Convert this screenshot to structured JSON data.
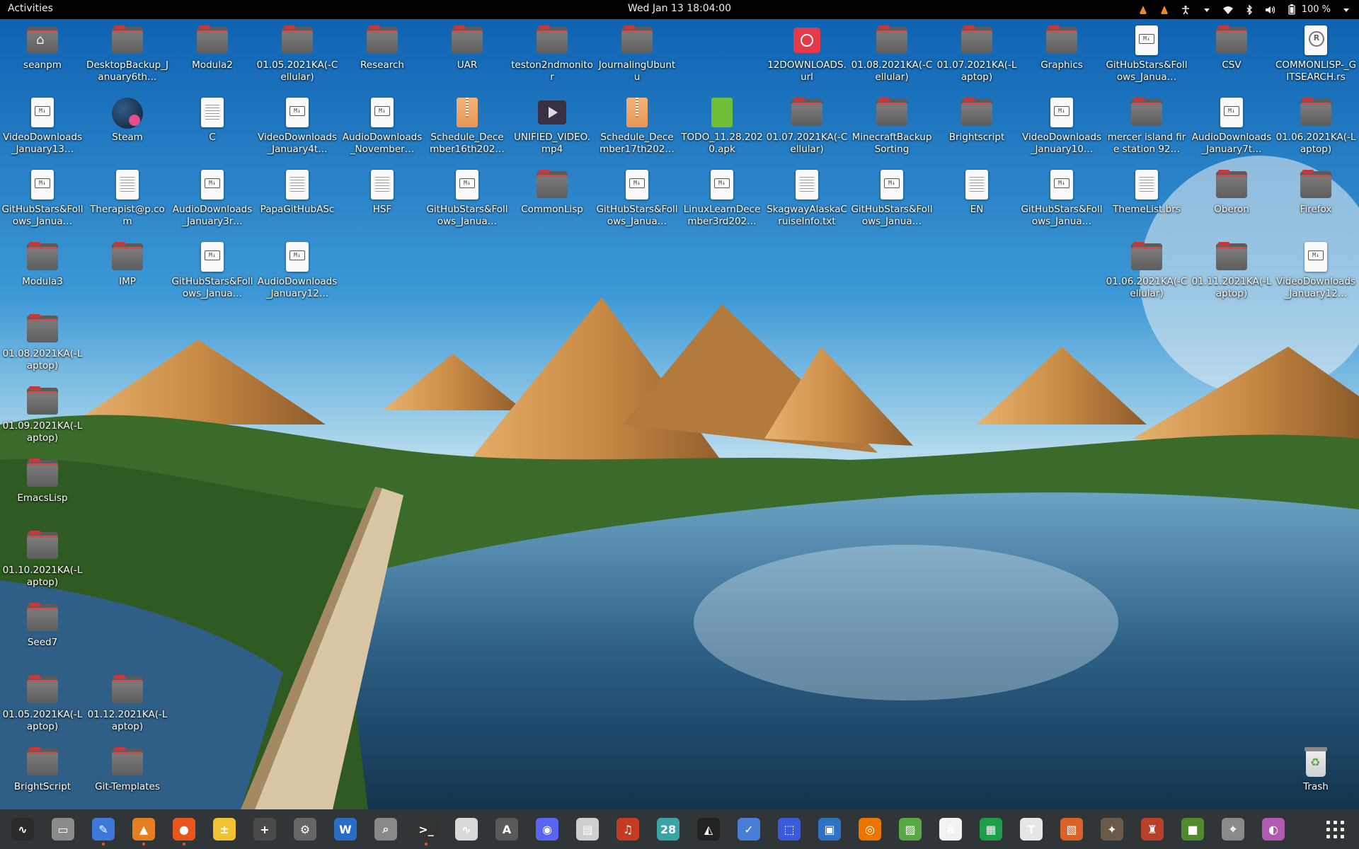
{
  "topbar": {
    "activities": "Activities",
    "clock": "Wed Jan 13  18:04:00",
    "battery": "100 %"
  },
  "desktop": {
    "icons": [
      {
        "label": "seanpm",
        "kind": "home"
      },
      {
        "label": "DesktopBackup_January6th…",
        "kind": "folder"
      },
      {
        "label": "Modula2",
        "kind": "folder"
      },
      {
        "label": "01.05.2021KA(-Cellular)",
        "kind": "folder"
      },
      {
        "label": "Research",
        "kind": "folder"
      },
      {
        "label": "UAR",
        "kind": "folder"
      },
      {
        "label": "teston2ndmonitor",
        "kind": "folder"
      },
      {
        "label": "JournalingUbuntu",
        "kind": "folder"
      },
      {
        "label": "12DOWNLOADS.url",
        "kind": "url"
      },
      {
        "label": "01.08.2021KA(-Cellular)",
        "kind": "folder"
      },
      {
        "label": "01.07.2021KA(-Laptop)",
        "kind": "folder"
      },
      {
        "label": "Graphics",
        "kind": "folder"
      },
      {
        "label": "GitHubStars&Follows_Janua…",
        "kind": "md"
      },
      {
        "label": "CSV",
        "kind": "folder"
      },
      {
        "label": "COMMONLISP-_GITSEARCH.rs",
        "kind": "rs"
      },
      {
        "label": "VideoDownloads_January13…",
        "kind": "md"
      },
      {
        "label": "Steam",
        "kind": "steam"
      },
      {
        "label": "C",
        "kind": "doc"
      },
      {
        "label": "VideoDownloads_January4t…",
        "kind": "md"
      },
      {
        "label": "AudioDownloads_November…",
        "kind": "md"
      },
      {
        "label": "Schedule_December16th202…",
        "kind": "archive"
      },
      {
        "label": "UNIFIED_VIDEO.mp4",
        "kind": "video"
      },
      {
        "label": "Schedule_December17th202…",
        "kind": "archive"
      },
      {
        "label": "TODO_11.28.2020.apk",
        "kind": "apk"
      },
      {
        "label": "01.07.2021KA(-Cellular)",
        "kind": "folder"
      },
      {
        "label": "MinecraftBackupSorting",
        "kind": "folder"
      },
      {
        "label": "Brightscript",
        "kind": "folder"
      },
      {
        "label": "VideoDownloads_January10…",
        "kind": "md"
      },
      {
        "label": "mercer island fire station 92…",
        "kind": "folder"
      },
      {
        "label": "AudioDownloads_January7t…",
        "kind": "md"
      },
      {
        "label": "01.06.2021KA(-Laptop)",
        "kind": "folder"
      },
      {
        "label": "GitHubStars&Follows_Janua…",
        "kind": "md"
      },
      {
        "label": "Therapist@p.com",
        "kind": "doc"
      },
      {
        "label": "AudioDownloads_January3r…",
        "kind": "md"
      },
      {
        "label": "PapaGitHubASc",
        "kind": "doc"
      },
      {
        "label": "HSF",
        "kind": "doc"
      },
      {
        "label": "GitHubStars&Follows_Janua…",
        "kind": "md"
      },
      {
        "label": "CommonLisp",
        "kind": "folder"
      },
      {
        "label": "GitHubStars&Follows_Janua…",
        "kind": "md"
      },
      {
        "label": "LinuxLearnDecember3rd202…",
        "kind": "md"
      },
      {
        "label": "SkagwayAlaskaCruiseInfo.txt",
        "kind": "doc"
      },
      {
        "label": "GitHubStars&Follows_Janua…",
        "kind": "md"
      },
      {
        "label": "EN",
        "kind": "doc"
      },
      {
        "label": "GitHubStars&Follows_Janua…",
        "kind": "md"
      },
      {
        "label": "ThemeList.brs",
        "kind": "doc"
      },
      {
        "label": "Oberon",
        "kind": "folder"
      },
      {
        "label": "Firefox",
        "kind": "folder"
      },
      {
        "label": "Modula3",
        "kind": "folder"
      },
      {
        "label": "IMP",
        "kind": "folder"
      },
      {
        "label": "GitHubStars&Follows_Janua…",
        "kind": "md"
      },
      {
        "label": "AudioDownloads_January12…",
        "kind": "md"
      },
      {
        "label": "01.06.2021KA(-Cellular)",
        "kind": "folder"
      },
      {
        "label": "01.11.2021KA(-Laptop)",
        "kind": "folder"
      },
      {
        "label": "VideoDownloads_January12…",
        "kind": "md"
      },
      {
        "label": "01.08.2021KA(-Laptop)",
        "kind": "folder"
      },
      {
        "label": "01.09.2021KA(-Laptop)",
        "kind": "folder"
      },
      {
        "label": "EmacsLisp",
        "kind": "folder"
      },
      {
        "label": "01.10.2021KA(-Laptop)",
        "kind": "folder"
      },
      {
        "label": "Seed7",
        "kind": "folder"
      },
      {
        "label": "01.05.2021KA(-Laptop)",
        "kind": "folder"
      },
      {
        "label": "01.12.2021KA(-Laptop)",
        "kind": "folder"
      },
      {
        "label": "BrightScript",
        "kind": "folder"
      },
      {
        "label": "Git-Templates",
        "kind": "folder"
      },
      {
        "label": "Trash",
        "kind": "trash"
      }
    ]
  },
  "dock": {
    "items": [
      {
        "name": "system-monitor-icon",
        "color": "#2b2b2b",
        "glyph": "∿",
        "running": false
      },
      {
        "name": "files-icon",
        "color": "#8a8a8a",
        "glyph": "▭",
        "running": false
      },
      {
        "name": "text-editor-icon",
        "color": "#3b78d8",
        "glyph": "✎",
        "running": true
      },
      {
        "name": "vlc-icon",
        "color": "#e67e22",
        "glyph": "▲",
        "running": true
      },
      {
        "name": "firefox-icon",
        "color": "#e8561e",
        "glyph": "●",
        "running": true
      },
      {
        "name": "calculator-icon",
        "color": "#f1c232",
        "glyph": "±",
        "running": false
      },
      {
        "name": "terminal-plus-icon",
        "color": "#4a4a4a",
        "glyph": "+",
        "running": false
      },
      {
        "name": "settings-icon",
        "color": "#666666",
        "glyph": "⚙",
        "running": false
      },
      {
        "name": "writer-icon",
        "color": "#2b6cc4",
        "glyph": "W",
        "running": false
      },
      {
        "name": "search-tool-icon",
        "color": "#888888",
        "glyph": "⌕",
        "running": false
      },
      {
        "name": "terminal-icon",
        "color": "#333333",
        "glyph": ">_",
        "running": true
      },
      {
        "name": "audio-editor-icon",
        "color": "#d9d9d9",
        "glyph": "∿",
        "running": false
      },
      {
        "name": "software-center-icon",
        "color": "#5a5a5a",
        "glyph": "A",
        "running": false
      },
      {
        "name": "discord-icon",
        "color": "#5865f2",
        "glyph": "◉",
        "running": false
      },
      {
        "name": "scanner-icon",
        "color": "#cfcfcf",
        "glyph": "▤",
        "running": false
      },
      {
        "name": "music-icon",
        "color": "#c23b22",
        "glyph": "♫",
        "running": false
      },
      {
        "name": "calendar-icon",
        "color": "#3aa3a3",
        "glyph": "28",
        "running": false
      },
      {
        "name": "inkscape-icon",
        "color": "#222222",
        "glyph": "◭",
        "running": false
      },
      {
        "name": "todo-icon",
        "color": "#4a7dd8",
        "glyph": "✓",
        "running": false
      },
      {
        "name": "screenshot-icon",
        "color": "#3b5bd8",
        "glyph": "⬚",
        "running": false
      },
      {
        "name": "virtualbox-icon",
        "color": "#2f72c4",
        "glyph": "▣",
        "running": false
      },
      {
        "name": "blender-icon",
        "color": "#ea7600",
        "glyph": "◎",
        "running": false
      },
      {
        "name": "image-viewer-icon",
        "color": "#5aa845",
        "glyph": "▨",
        "running": false
      },
      {
        "name": "character-map-icon",
        "color": "#f2f2f2",
        "glyph": "à",
        "running": false
      },
      {
        "name": "spreadsheet-icon",
        "color": "#1e9e4a",
        "glyph": "▦",
        "running": false
      },
      {
        "name": "fonts-icon",
        "color": "#e6e6e6",
        "glyph": "T",
        "running": false
      },
      {
        "name": "presentation-icon",
        "color": "#d9622b",
        "glyph": "▧",
        "running": false
      },
      {
        "name": "gimp-icon",
        "color": "#6b5a4a",
        "glyph": "✦",
        "running": false
      },
      {
        "name": "game-icon",
        "color": "#b8412c",
        "glyph": "♜",
        "running": false
      },
      {
        "name": "minecraft-icon",
        "color": "#4f8a2f",
        "glyph": "■",
        "running": false
      },
      {
        "name": "maps-icon",
        "color": "#8a8a8a",
        "glyph": "⌖",
        "running": false
      },
      {
        "name": "tweaks-icon",
        "color": "#b05ab0",
        "glyph": "◐",
        "running": false
      }
    ]
  }
}
